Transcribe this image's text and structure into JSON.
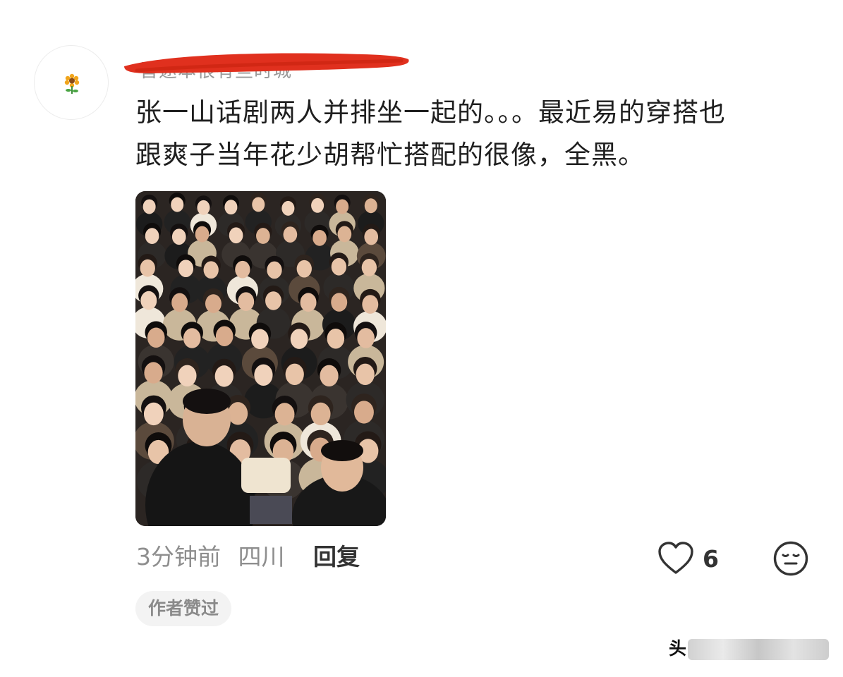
{
  "comment": {
    "username": "晋途本很有些时城",
    "text_lines": [
      "张一山话剧两人并排坐一起的。。。最近易的穿搭也",
      "跟爽子当年花少胡帮忙搭配的很像，全黑。"
    ],
    "time": "3分钟前",
    "location": "四川",
    "reply_label": "回复",
    "like_count": "6",
    "author_liked_badge": "作者赞过"
  },
  "icons": {
    "avatar": "sunflower-icon",
    "like": "heart-outline-icon",
    "reaction": "neutral-face-icon"
  },
  "colors": {
    "redaction": "#e0301e",
    "secondary_text": "#8e8e8e",
    "primary_text": "#1f1f1f",
    "badge_bg": "#f3f3f3"
  },
  "watermark": {
    "brand": "头"
  }
}
